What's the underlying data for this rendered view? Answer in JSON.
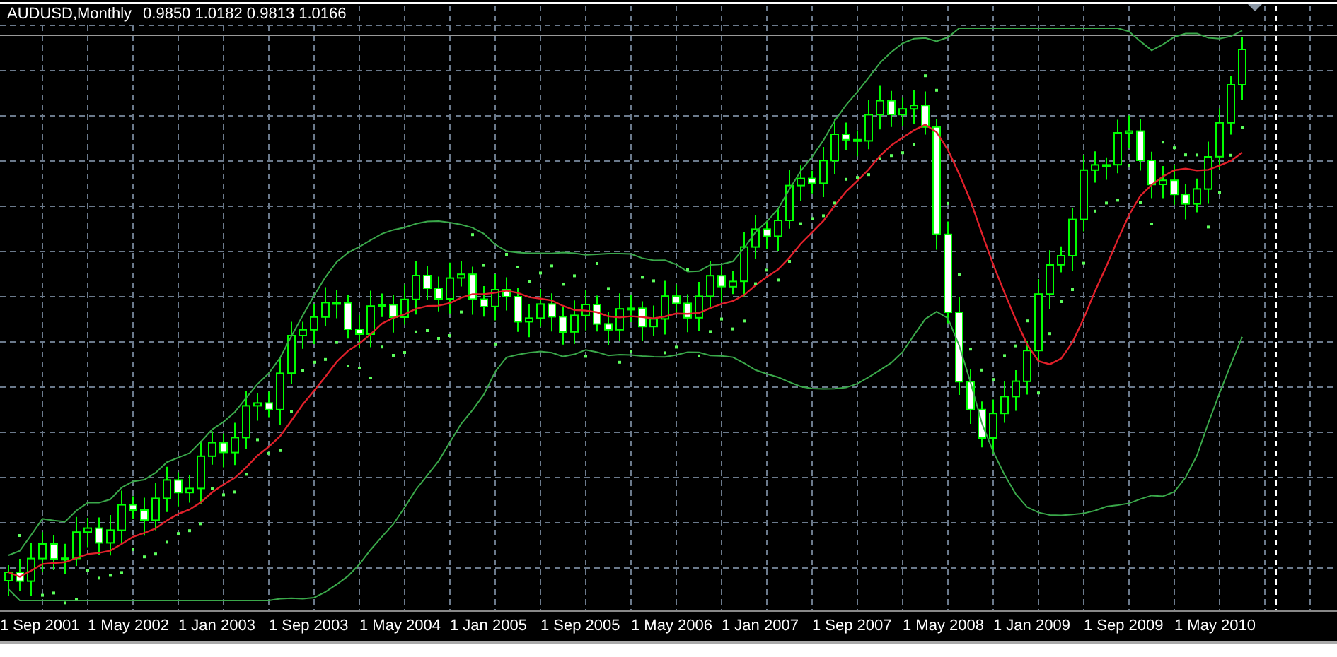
{
  "chart": {
    "symbol": "AUDUSD,Monthly",
    "ohlc": "0.9850 1.0182 0.9813 1.0166",
    "x_axis_labels": [
      "1 Sep 2001",
      "1 May 2002",
      "1 Jan 2003",
      "1 Sep 2003",
      "1 May 2004",
      "1 Jan 2005",
      "1 Sep 2005",
      "1 May 2006",
      "1 Jan 2007",
      "1 Sep 2007",
      "1 May 2008",
      "1 Jan 2009",
      "1 Sep 2009",
      "1 May 2010"
    ]
  }
}
